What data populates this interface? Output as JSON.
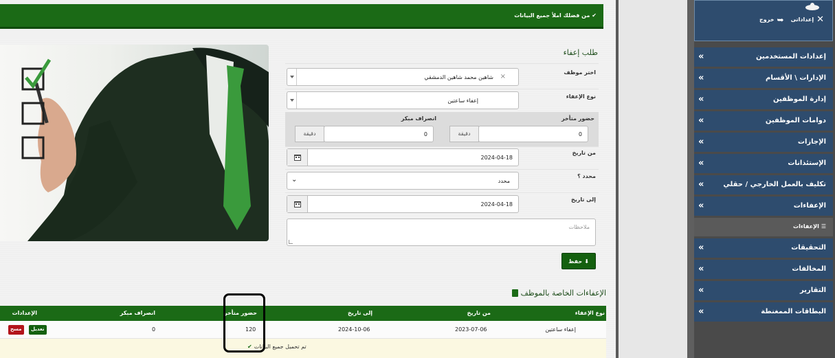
{
  "alert_top": "من فضلك املأ جميع البيانات",
  "form": {
    "title": "طلب إعفاء",
    "employee_label": "اختر موظف",
    "employee_value": "شاهين محمد شاهين الدمشقي",
    "exemption_type_label": "نوع الإعفاء",
    "exemption_type_value": "إعفاء ساعتين",
    "late_arrival_label": "حضور متأخر",
    "late_arrival_value": "0",
    "early_leave_label": "انصراف مبكر",
    "early_leave_value": "0",
    "minute_unit": "دقيقة",
    "from_date_label": "من تاريخ",
    "from_date_value": "2024-04-18",
    "specified_label": "محدد ؟",
    "specified_value": "محدد",
    "to_date_label": "إلى تاريخ",
    "to_date_value": "2024-04-18",
    "notes_placeholder": "ملاحظات",
    "save_label": "حفظ"
  },
  "table": {
    "section_title": "الإعفاءات الخاصة بالموظف",
    "headers": {
      "type": "نوع الإعفاء",
      "from": "من تاريخ",
      "to": "إلى تاريخ",
      "late": "حضور متأخر",
      "early": "انصراف مبكر",
      "actions": "الإعدادات"
    },
    "rows": [
      {
        "type": "إعفاء ساعتين",
        "from": "2023-07-06",
        "to": "2024-10-06",
        "late": "120",
        "early": "0",
        "edit": "تعديل",
        "delete": "مسح"
      }
    ],
    "footer": "تم تحميل جميع البيانات"
  },
  "userbox": {
    "settings_label": "إعداداتى",
    "logout_label": "خروج"
  },
  "sidebar": {
    "items": [
      "إعدادات المستخدمين",
      "الإدارات \\ الأقسام",
      "إدارة الموظفين",
      "دوامات الموظفين",
      "الإجازات",
      "الإستئذانات",
      "تكليف بالعمل الخارجي / حقلي",
      "الإعفاءات",
      "التحقيقات",
      "المخالفات",
      "التقارير",
      "البطاقات الممغنطة"
    ],
    "submenu_label": "الإعفاءات"
  },
  "colors": {
    "primary_green": "#1b6a16",
    "sidebar_blue": "#2e4c6e",
    "delete_red": "#b3141b"
  }
}
